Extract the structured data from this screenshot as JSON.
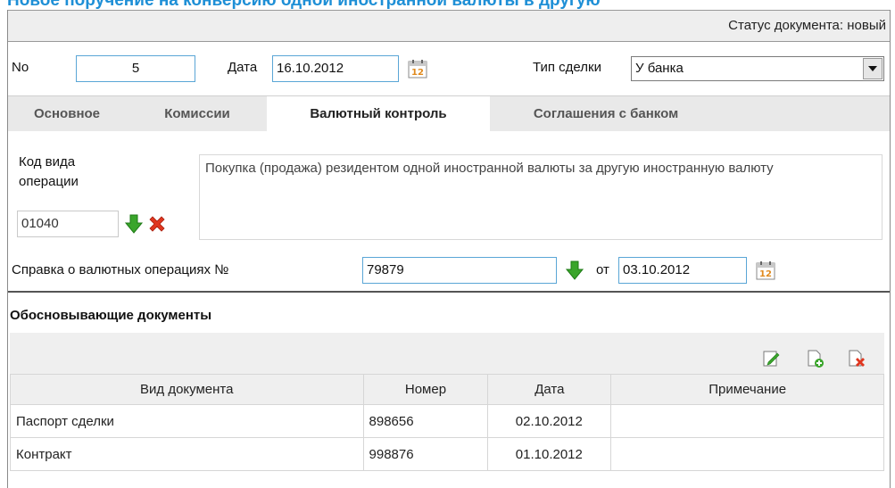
{
  "window": {
    "title": "Новое поручение на конверсию одной иностранной валюты в другую"
  },
  "status": {
    "text": "Статус документа: новый"
  },
  "header": {
    "number_label": "No",
    "number_value": "5",
    "date_label": "Дата",
    "date_value": "16.10.2012",
    "deal_type_label": "Тип сделки",
    "deal_type_value": "У банка"
  },
  "tabs": [
    {
      "label": "Основное",
      "active": false
    },
    {
      "label": "Комиссии",
      "active": false
    },
    {
      "label": "Валютный контроль",
      "active": true
    },
    {
      "label": "Соглашения с банком",
      "active": false
    }
  ],
  "currency_control": {
    "op_code_label_line1": "Код вида",
    "op_code_label_line2": "операции",
    "op_code_value": "01040",
    "op_description": "Покупка (продажа) резидентом одной иностранной валюты за другую иностранную валюту",
    "certificate_label": "Справка о валютных операциях №",
    "certificate_number": "79879",
    "certificate_from_label": "от",
    "certificate_date": "03.10.2012"
  },
  "documents": {
    "section_title": "Обосновывающие документы",
    "columns": [
      "Вид документа",
      "Номер",
      "Дата",
      "Примечание"
    ],
    "rows": [
      [
        "Паспорт сделки",
        "898656",
        "02.10.2012",
        ""
      ],
      [
        "Контракт",
        "998876",
        "01.10.2012",
        ""
      ]
    ]
  },
  "icons": {
    "calendar": "calendar-icon",
    "select_arrow": "chevron-down-icon",
    "pick": "green-down-arrow-icon",
    "clear": "red-x-icon",
    "edit": "edit-document-icon",
    "add": "add-document-icon",
    "delete": "delete-document-icon"
  },
  "colors": {
    "title_blue": "#1e8fd6",
    "field_border": "#5aa6d6",
    "pick_green": "#3aa52b",
    "clear_red": "#e0361f"
  }
}
